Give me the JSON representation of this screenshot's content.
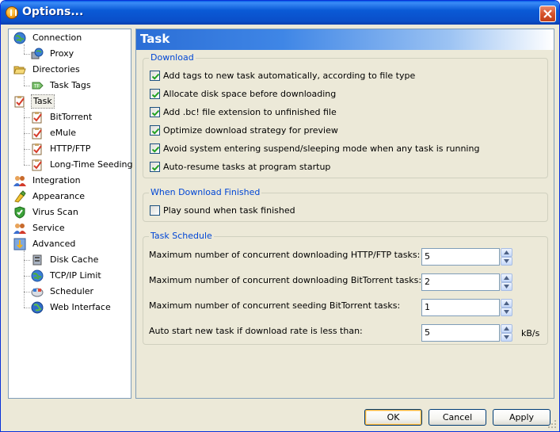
{
  "window": {
    "title": "Options..."
  },
  "tree": {
    "items": [
      {
        "label": "Connection",
        "icon": "globe-network-icon",
        "level": 0
      },
      {
        "label": "Proxy",
        "icon": "proxy-globe-icon",
        "level": 1
      },
      {
        "label": "Directories",
        "icon": "folder-open-icon",
        "level": 0
      },
      {
        "label": "Task Tags",
        "icon": "tag-icon",
        "level": 1
      },
      {
        "label": "Task",
        "icon": "task-clipboard-icon",
        "level": 0,
        "selected": true
      },
      {
        "label": "BitTorrent",
        "icon": "task-clipboard-icon",
        "level": 1
      },
      {
        "label": "eMule",
        "icon": "task-clipboard-icon",
        "level": 1
      },
      {
        "label": "HTTP/FTP",
        "icon": "task-clipboard-icon",
        "level": 1
      },
      {
        "label": "Long-Time Seeding",
        "icon": "task-clipboard-icon",
        "level": 1
      },
      {
        "label": "Integration",
        "icon": "users-icon",
        "level": 0
      },
      {
        "label": "Appearance",
        "icon": "paint-icon",
        "level": 0
      },
      {
        "label": "Virus Scan",
        "icon": "shield-icon",
        "level": 0
      },
      {
        "label": "Service",
        "icon": "users-icon",
        "level": 0
      },
      {
        "label": "Advanced",
        "icon": "advanced-gear-icon",
        "level": 0
      },
      {
        "label": "Disk Cache",
        "icon": "disk-cache-icon",
        "level": 1
      },
      {
        "label": "TCP/IP Limit",
        "icon": "globe-network-icon",
        "level": 1
      },
      {
        "label": "Scheduler",
        "icon": "scheduler-icon",
        "level": 1
      },
      {
        "label": "Web Interface",
        "icon": "globe-icon",
        "level": 1
      }
    ]
  },
  "panel": {
    "title": "Task",
    "download": {
      "title": "Download",
      "options": [
        {
          "label": "Add tags to new task automatically, according to file type",
          "checked": true
        },
        {
          "label": "Allocate disk space before downloading",
          "checked": true
        },
        {
          "label": "Add .bc! file extension to unfinished file",
          "checked": true
        },
        {
          "label": "Optimize download strategy for preview",
          "checked": true
        },
        {
          "label": "Avoid system entering suspend/sleeping mode when any task is running",
          "checked": true
        },
        {
          "label": "Auto-resume tasks at program startup",
          "checked": true
        }
      ]
    },
    "finished": {
      "title": "When Download Finished",
      "options": [
        {
          "label": "Play sound when task finished",
          "checked": false
        }
      ]
    },
    "schedule": {
      "title": "Task Schedule",
      "rows": [
        {
          "label": "Maximum number of concurrent downloading HTTP/FTP tasks:",
          "value": "5"
        },
        {
          "label": "Maximum number of concurrent downloading BitTorrent tasks:",
          "value": "2"
        },
        {
          "label": "Maximum number of concurrent seeding BitTorrent tasks:",
          "value": "1"
        },
        {
          "label": "Auto start new task if download rate is less than:",
          "value": "5",
          "unit": "kB/s"
        }
      ]
    }
  },
  "buttons": {
    "ok": "OK",
    "cancel": "Cancel",
    "apply": "Apply"
  }
}
